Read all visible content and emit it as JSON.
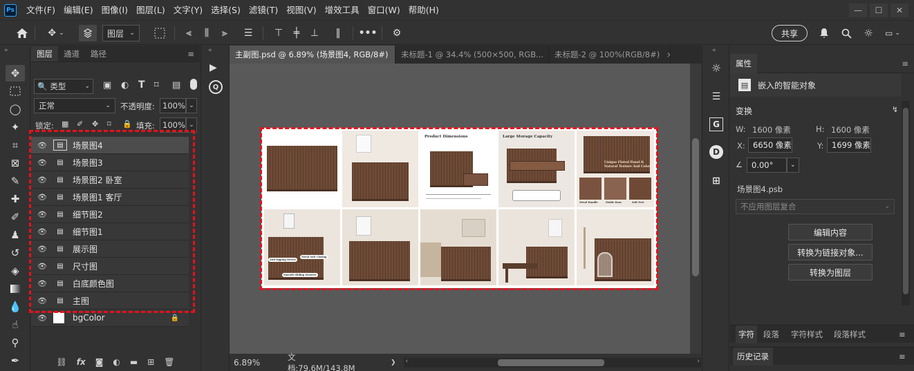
{
  "app": {
    "logo": "Ps"
  },
  "menubar": {
    "items": [
      "文件(F)",
      "编辑(E)",
      "图像(I)",
      "图层(L)",
      "文字(Y)",
      "选择(S)",
      "滤镜(T)",
      "视图(V)",
      "增效工具",
      "窗口(W)",
      "帮助(H)"
    ],
    "window_controls": [
      "—",
      "☐",
      "✕"
    ]
  },
  "options": {
    "auto_select_target": "图层",
    "share": "共享"
  },
  "layers_panel": {
    "tabs": [
      "图层",
      "通道",
      "路径"
    ],
    "filter_kind": "类型",
    "blend_mode": "正常",
    "opacity_label": "不透明度:",
    "opacity": "100%",
    "lock_label": "锁定:",
    "fill_label": "填充:",
    "fill": "100%",
    "layers": [
      {
        "name": "场景图4",
        "selected": true
      },
      {
        "name": "场景图3"
      },
      {
        "name": "场景图2 卧室"
      },
      {
        "name": "场景图1 客厅"
      },
      {
        "name": "细节图2"
      },
      {
        "name": "细节图1"
      },
      {
        "name": "展示图"
      },
      {
        "name": "尺寸图"
      },
      {
        "name": "白底颜色图"
      },
      {
        "name": "主图"
      },
      {
        "name": "bgColor"
      }
    ],
    "highlight_color": "#e8101a"
  },
  "documents": {
    "tabs": [
      "主副图.psd @ 6.89% (场景图4, RGB/8#)",
      "未标题-1 @ 34.4% (500×500, RGB...",
      "未标题-2 @ 100%(RGB/8#)"
    ],
    "close_glyph": "×"
  },
  "canvas_text": {
    "dims_title": "Product Dimensions",
    "storage_title": "Large Storage Capacity",
    "panel_title": "Unique Fluted Panel & Natural Texture And Color",
    "detail_labels": [
      "Metal Handle",
      "Stable Base",
      "Soft Feet"
    ],
    "callouts": [
      "Anti-tipping Device",
      "Metal Soft Closing",
      "Smooth Sliding Drawers"
    ]
  },
  "status": {
    "zoom": "6.89%",
    "doc_info": "文档:79.6M/143.8M",
    "arrow": "❯"
  },
  "properties": {
    "tab": "属性",
    "object_type": "嵌入的智能对象",
    "transform_label": "变换",
    "w_label": "W:",
    "w_value": "1600 像素",
    "h_label": "H:",
    "h_value": "1600 像素",
    "x_label": "X:",
    "x_value": "6650 像素",
    "y_label": "Y:",
    "y_value": "1699 像素",
    "angle": "0.00°",
    "smart_file": "场景图4.psb",
    "comp_placeholder": "不应用图层复合",
    "buttons": [
      "编辑内容",
      "转换为链接对象...",
      "转换为图层"
    ]
  },
  "bottom_tabs": {
    "row1": [
      "字符",
      "段落",
      "字符样式",
      "段落样式"
    ],
    "row2": "历史记录"
  }
}
